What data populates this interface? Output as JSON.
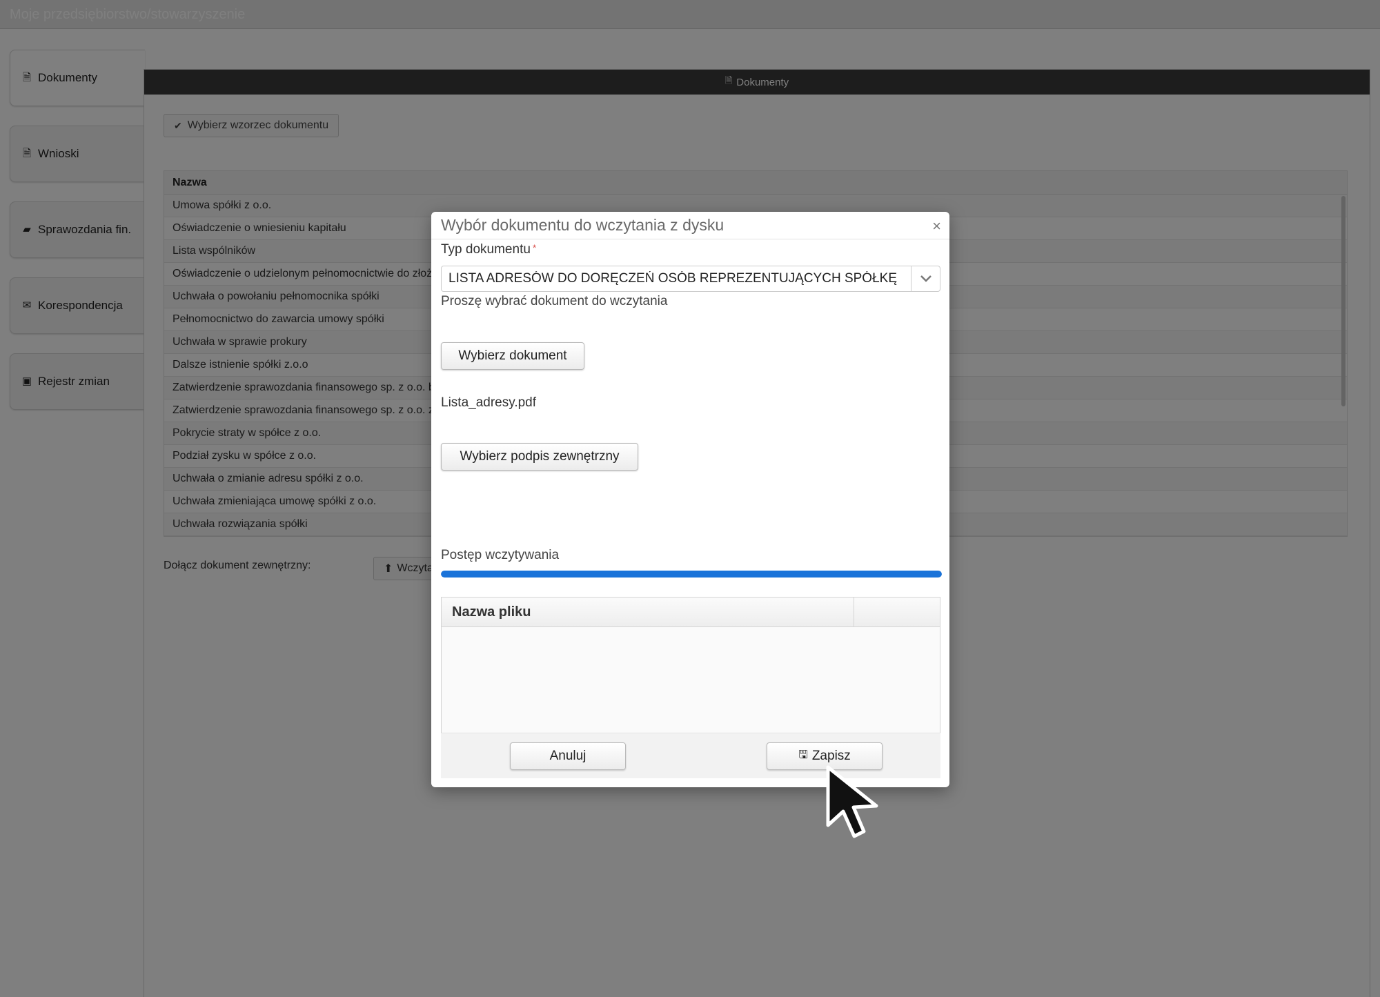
{
  "app": {
    "title": "Moje przedsiębiorstwo/stowarzyszenie"
  },
  "sidebar": {
    "items": [
      {
        "label": "Dokumenty",
        "icon": "document-icon"
      },
      {
        "label": "Wnioski",
        "icon": "document-lock-icon"
      },
      {
        "label": "Sprawozdania fin.",
        "icon": "folder-open-icon"
      },
      {
        "label": "Korespondencja",
        "icon": "envelope-icon"
      },
      {
        "label": "Rejestr zmian",
        "icon": "briefcase-icon"
      }
    ]
  },
  "panel": {
    "title": "Dokumenty",
    "template_button": "Wybierz wzorzec dokumentu",
    "table": {
      "header": "Nazwa",
      "rows": [
        "Umowa spółki z o.o.",
        "Oświadczenie o wniesieniu kapitału",
        "Lista wspólników",
        "Oświadczenie o udzielonym pełnomocnictwie do złożenia",
        "Uchwała o powołaniu pełnomocnika spółki",
        "Pełnomocnictwo do zawarcia umowy spółki",
        "Uchwała w sprawie prokury",
        "Dalsze istnienie spółki z.o.o",
        "Zatwierdzenie sprawozdania finansowego sp. z o.o. b",
        "Zatwierdzenie sprawozdania finansowego sp. z o.o. z",
        "Pokrycie straty w spółce z o.o.",
        "Podział zysku w spółce z o.o.",
        "Uchwała o zmianie adresu spółki z o.o.",
        "Uchwała zmieniająca umowę spółki z o.o.",
        "Uchwała rozwiązania spółki"
      ]
    },
    "attach_label": "Dołącz dokument zewnętrzny:",
    "attach_button": "Wczytaj"
  },
  "modal": {
    "title": "Wybór dokumentu do wczytania z dysku",
    "close": "×",
    "type_label": "Typ dokumentu",
    "required_mark": "*",
    "type_value": "LISTA ADRESÓW DO  DORĘCZEŃ   OSÓB REPREZENTUJĄCYCH SPÓŁKĘ",
    "hint": "Proszę wybrać dokument do wczytania",
    "choose_document": "Wybierz dokument",
    "file_name": "Lista_adresy.pdf",
    "choose_signature": "Wybierz podpis zewnętrzny",
    "progress_label": "Postęp wczytywania",
    "progress": 1.0,
    "file_table_header": "Nazwa pliku",
    "cancel": "Anuluj",
    "save": "Zapisz"
  },
  "colors": {
    "progress": "#1a73d9",
    "header_dark": "#3a3a3a",
    "required": "#d9534f"
  }
}
